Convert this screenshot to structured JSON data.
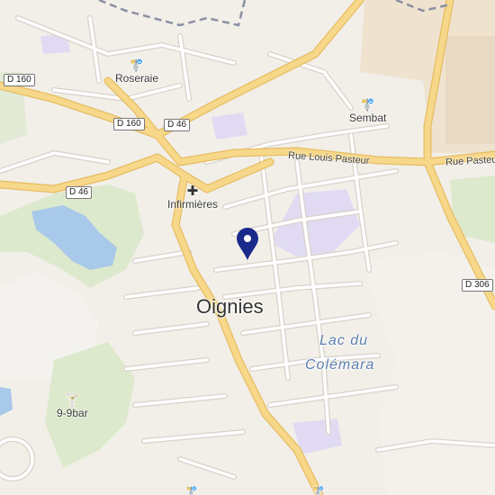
{
  "map": {
    "town_label": "Oignies",
    "lake_label_line1": "Lac du",
    "lake_label_line2": "Colémara",
    "colors": {
      "background": "#f2efe9",
      "main_road": "#f7d88a",
      "main_road_casing": "#e9bf63",
      "minor_road": "#ffffff",
      "minor_road_casing": "#d9d4cc",
      "water": "#a9c9ea",
      "park": "#dbe8c9",
      "school": "#e1dcf3",
      "industrial": "#efe2cf",
      "boundary": "#8a8fa3",
      "marker": "#1a2a8a"
    },
    "pois": [
      {
        "id": "roseraie",
        "label": "Roseraie",
        "icon": "bus-stop-icon",
        "glyph": "🚏"
      },
      {
        "id": "sembat",
        "label": "Sembat",
        "icon": "bus-stop-icon",
        "glyph": "🚏"
      },
      {
        "id": "infirmieres",
        "label": "Infirmières",
        "icon": "cross-icon",
        "glyph": "✚"
      },
      {
        "id": "bar",
        "label": "9-9bar",
        "icon": "cocktail-glass-icon",
        "glyph": "🍸"
      }
    ],
    "road_shields": [
      {
        "id": "d160-west",
        "label": "D 160"
      },
      {
        "id": "d160-center",
        "label": "D 160"
      },
      {
        "id": "d46-north",
        "label": "D 46"
      },
      {
        "id": "d46-west",
        "label": "D 46"
      },
      {
        "id": "d306",
        "label": "D 306"
      }
    ],
    "street_labels": [
      {
        "id": "rue-louis-pasteur-west",
        "label": "Rue Louis Pasteur"
      },
      {
        "id": "rue-pasteur-east",
        "label": "Rue Pasteur"
      }
    ],
    "marker": {
      "icon": "map-pin-icon"
    }
  }
}
